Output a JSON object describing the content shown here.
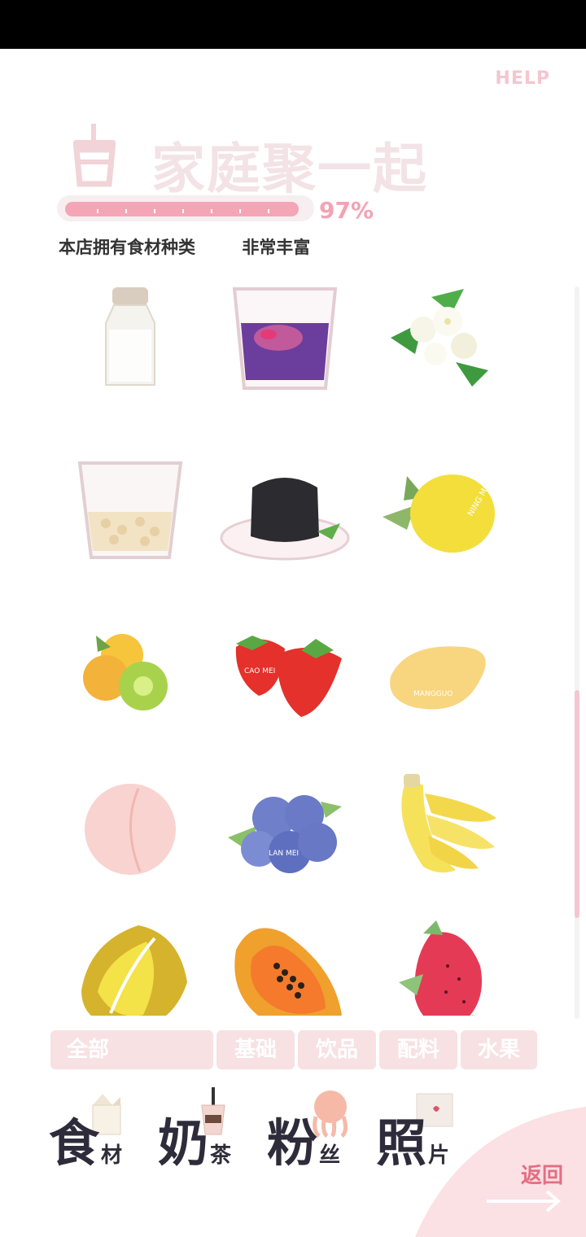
{
  "header": {
    "help_label": "HELP",
    "title": "家庭聚一起",
    "progress": {
      "value": 97,
      "label": "97%"
    },
    "info": [
      "本店拥有食材种类",
      "非常丰富"
    ]
  },
  "colors": {
    "accent_pink": "#f4a6b6",
    "title_faded": "#f3e3e6",
    "filter_bg": "#f7e1e3",
    "nav_text": "#2e2c3a",
    "back_text": "#e26f83"
  },
  "ingredients": [
    {
      "name": "salt-shaker-icon"
    },
    {
      "name": "taro-pudding-cup-icon"
    },
    {
      "name": "jasmine-flowers-icon"
    },
    {
      "name": "oat-cup-icon"
    },
    {
      "name": "grass-jelly-icon"
    },
    {
      "name": "lemon-icon",
      "label": "NING MENG"
    },
    {
      "name": "kumquat-lime-icon"
    },
    {
      "name": "strawberry-icon",
      "label": "CAO MEI"
    },
    {
      "name": "mango-icon",
      "label": "MANGGUO"
    },
    {
      "name": "peach-icon"
    },
    {
      "name": "blueberry-icon",
      "label": "LAN MEI"
    },
    {
      "name": "banana-icon"
    },
    {
      "name": "durian-icon"
    },
    {
      "name": "papaya-icon"
    },
    {
      "name": "dragon-fruit-icon"
    }
  ],
  "filters": [
    "全部",
    "基础",
    "饮品",
    "配料",
    "水果"
  ],
  "nav": [
    {
      "big": "食",
      "small": "材",
      "icon": "milk-carton-icon"
    },
    {
      "big": "奶",
      "small": "茶",
      "icon": "milk-tea-icon"
    },
    {
      "big": "粉",
      "small": "丝",
      "icon": "octopus-icon"
    },
    {
      "big": "照",
      "small": "片",
      "icon": "photo-icon"
    }
  ],
  "back_label": "返回"
}
